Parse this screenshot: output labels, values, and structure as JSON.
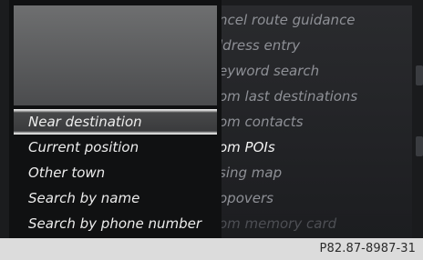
{
  "background_menu": {
    "items": [
      {
        "label": "ncel route guidance",
        "state": "normal"
      },
      {
        "label": "ldress entry",
        "state": "normal"
      },
      {
        "label": "eyword search",
        "state": "normal"
      },
      {
        "label": "om last destinations",
        "state": "normal"
      },
      {
        "label": "om contacts",
        "state": "normal"
      },
      {
        "label": "om POIs",
        "state": "active"
      },
      {
        "label": "sing map",
        "state": "normal"
      },
      {
        "label": "opovers",
        "state": "normal"
      },
      {
        "label": "om memory card",
        "state": "faded"
      }
    ]
  },
  "popup": {
    "options": [
      {
        "label": "Near destination",
        "selected": true
      },
      {
        "label": "Current position",
        "selected": false
      },
      {
        "label": "Other town",
        "selected": false
      },
      {
        "label": "Search by name",
        "selected": false
      },
      {
        "label": "Search by phone number",
        "selected": false
      }
    ]
  },
  "footer": {
    "code": "P82.87-8987-31"
  }
}
